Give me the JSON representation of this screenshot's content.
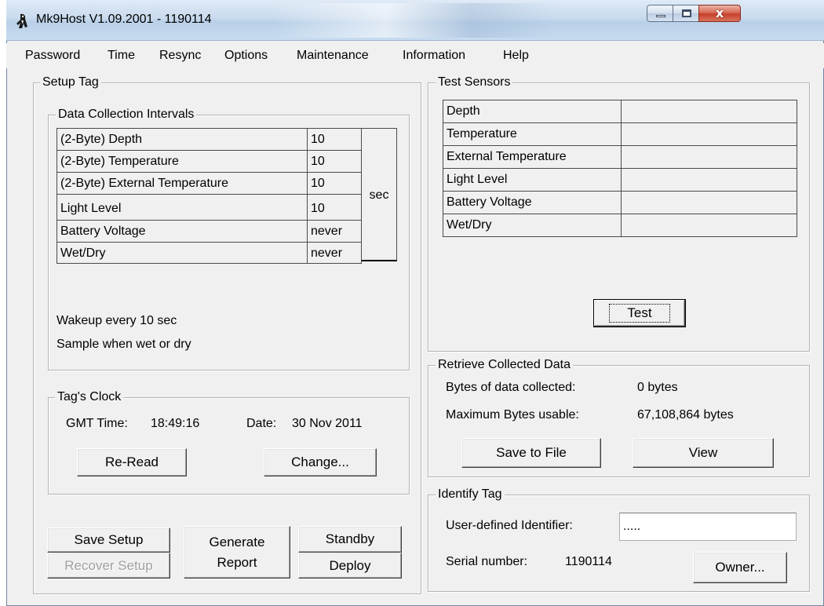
{
  "window": {
    "title": "Mk9Host V1.09.2001 - 1190114",
    "close_glyph": "x"
  },
  "menu": [
    "Password",
    "Time",
    "Resync",
    "Options",
    "Maintenance",
    "Information",
    "Help"
  ],
  "setup_tag": {
    "label": "Setup Tag",
    "intervals": {
      "label": "Data Collection Intervals",
      "rows": [
        {
          "name": "(2-Byte) Depth",
          "value": "10"
        },
        {
          "name": "(2-Byte) Temperature",
          "value": "10"
        },
        {
          "name": "(2-Byte) External Temperature",
          "value": "10"
        },
        {
          "name": "Light Level",
          "value": "10"
        },
        {
          "name": "Battery Voltage",
          "value": "never"
        },
        {
          "name": "Wet/Dry",
          "value": "never"
        }
      ],
      "unit": "sec",
      "wakeup_text": "Wakeup every 10 sec",
      "sample_text": "Sample when wet or dry"
    },
    "clock": {
      "label": "Tag's Clock",
      "gmt_label": "GMT Time:",
      "gmt_value": "18:49:16",
      "date_label": "Date:",
      "date_value": "30 Nov 2011",
      "reread_button": "Re-Read",
      "change_button": "Change..."
    },
    "buttons": {
      "save_setup": "Save Setup",
      "recover_setup": "Recover Setup",
      "generate_line1": "Generate",
      "generate_line2": "Report",
      "standby": "Standby",
      "deploy": "Deploy"
    }
  },
  "test_sensors": {
    "label": "Test Sensors",
    "rows": [
      {
        "name": "Depth",
        "value": ""
      },
      {
        "name": "Temperature",
        "value": ""
      },
      {
        "name": "External Temperature",
        "value": ""
      },
      {
        "name": "Light Level",
        "value": ""
      },
      {
        "name": "Battery Voltage",
        "value": ""
      },
      {
        "name": "Wet/Dry",
        "value": ""
      }
    ],
    "test_button": "Test"
  },
  "retrieve": {
    "label": "Retrieve Collected Data",
    "bytes_collected_label": "Bytes of data collected:",
    "bytes_collected_value": "0 bytes",
    "max_bytes_label": "Maximum Bytes usable:",
    "max_bytes_value": "67,108,864 bytes",
    "save_button": "Save to File",
    "view_button": "View"
  },
  "identify": {
    "label": "Identify Tag",
    "user_id_label": "User-defined Identifier:",
    "user_id_value": ".....",
    "serial_label": "Serial number:",
    "serial_value": "1190114",
    "owner_button": "Owner..."
  }
}
